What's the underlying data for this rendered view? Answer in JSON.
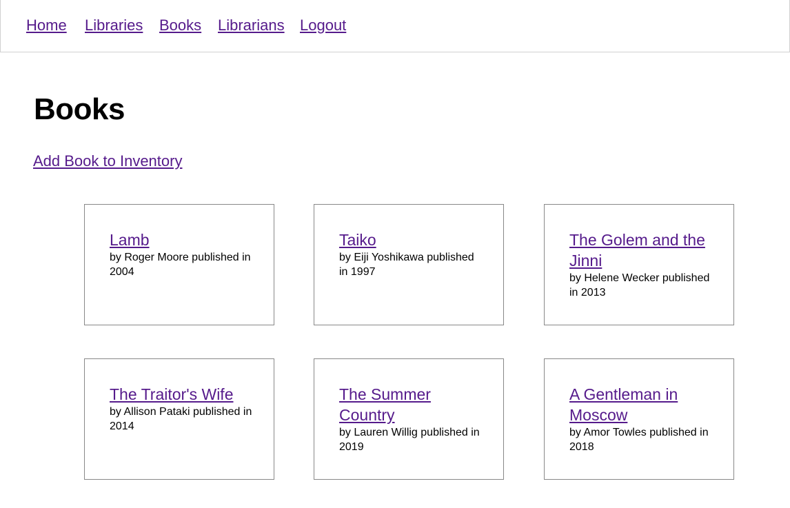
{
  "nav": {
    "items": [
      {
        "label": "Home"
      },
      {
        "label": "Libraries"
      },
      {
        "label": "Books"
      },
      {
        "label": "Librarians"
      },
      {
        "label": "Logout"
      }
    ]
  },
  "page": {
    "title": "Books",
    "add_link": "Add Book to Inventory"
  },
  "books": [
    {
      "title": "Lamb",
      "meta": "by Roger Moore published in 2004"
    },
    {
      "title": "Taiko",
      "meta": "by Eiji Yoshikawa published in 1997"
    },
    {
      "title": "The Golem and the Jinni",
      "meta": "by Helene Wecker published in 2013"
    },
    {
      "title": "The Traitor's Wife",
      "meta": "by Allison Pataki published in 2014"
    },
    {
      "title": "The Summer Country",
      "meta": "by Lauren Willig published in 2019"
    },
    {
      "title": "A Gentleman in Moscow",
      "meta": "by Amor Towles published in 2018"
    }
  ],
  "colors": {
    "link": "#551A8B",
    "card_border": "#888888"
  }
}
